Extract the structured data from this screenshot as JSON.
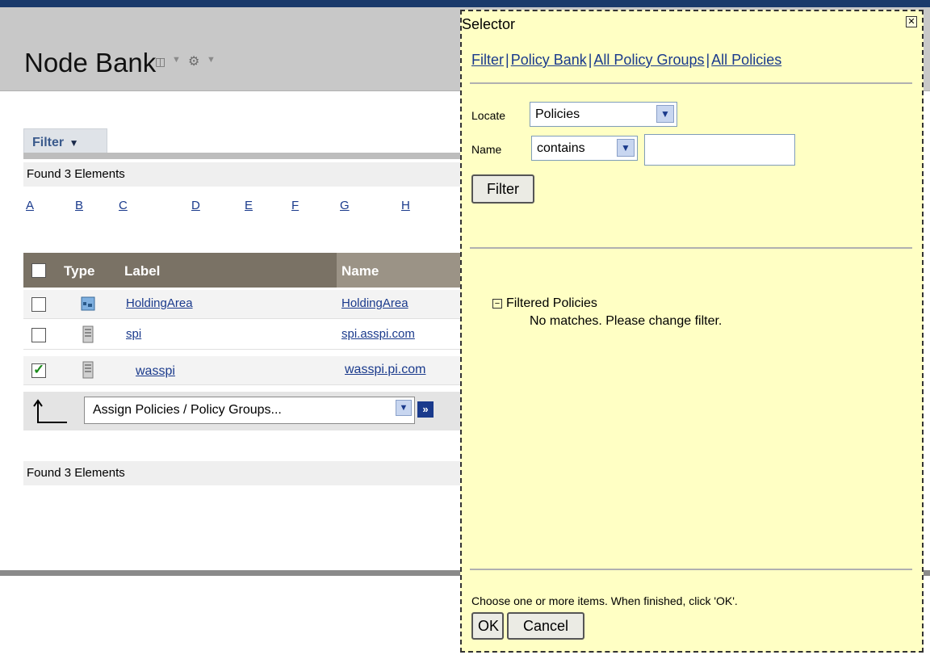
{
  "header": {
    "title": "Node Bank",
    "icons": [
      "window-icon",
      "chevron-down-icon",
      "gear-icon",
      "chevron-down-icon"
    ]
  },
  "filter_tab": {
    "label": "Filter"
  },
  "found_top": "Found 3 Elements",
  "found_bottom": "Found 3 Elements",
  "alphabet": [
    "A",
    "B",
    "C",
    "D",
    "E",
    "F",
    "G",
    "H"
  ],
  "table": {
    "columns": [
      "Type",
      "Label",
      "Name"
    ],
    "rows": [
      {
        "label": "HoldingArea",
        "name": "HoldingArea",
        "checked": false,
        "type_icon": "folder-icon"
      },
      {
        "label": "spi",
        "name": "spi.asspi.com",
        "checked": false,
        "type_icon": "server-icon"
      },
      {
        "label": "wasspi",
        "name": "wasspi.pi.com",
        "checked": true,
        "type_icon": "server-icon"
      }
    ]
  },
  "actions": {
    "selected": "Assign Policies / Policy Groups..."
  },
  "selector": {
    "title": "Selector",
    "nav": [
      "Filter",
      "Policy Bank",
      "All Policy Groups",
      "All Policies"
    ],
    "locate_label": "Locate",
    "locate_value": "Policies",
    "name_label": "Name",
    "name_operator": "contains",
    "name_value": "",
    "filter_button": "Filter",
    "tree_title": "Filtered Policies",
    "tree_message": "No matches. Please change filter.",
    "instructions": "Choose one or more items. When finished, click 'OK'.",
    "ok_button": "OK",
    "cancel_button": "Cancel"
  },
  "colors": {
    "selector_bg": "#ffffc4",
    "link": "#1a3a8c",
    "table_header": "#7a7265",
    "check": "#1a8a1a"
  }
}
